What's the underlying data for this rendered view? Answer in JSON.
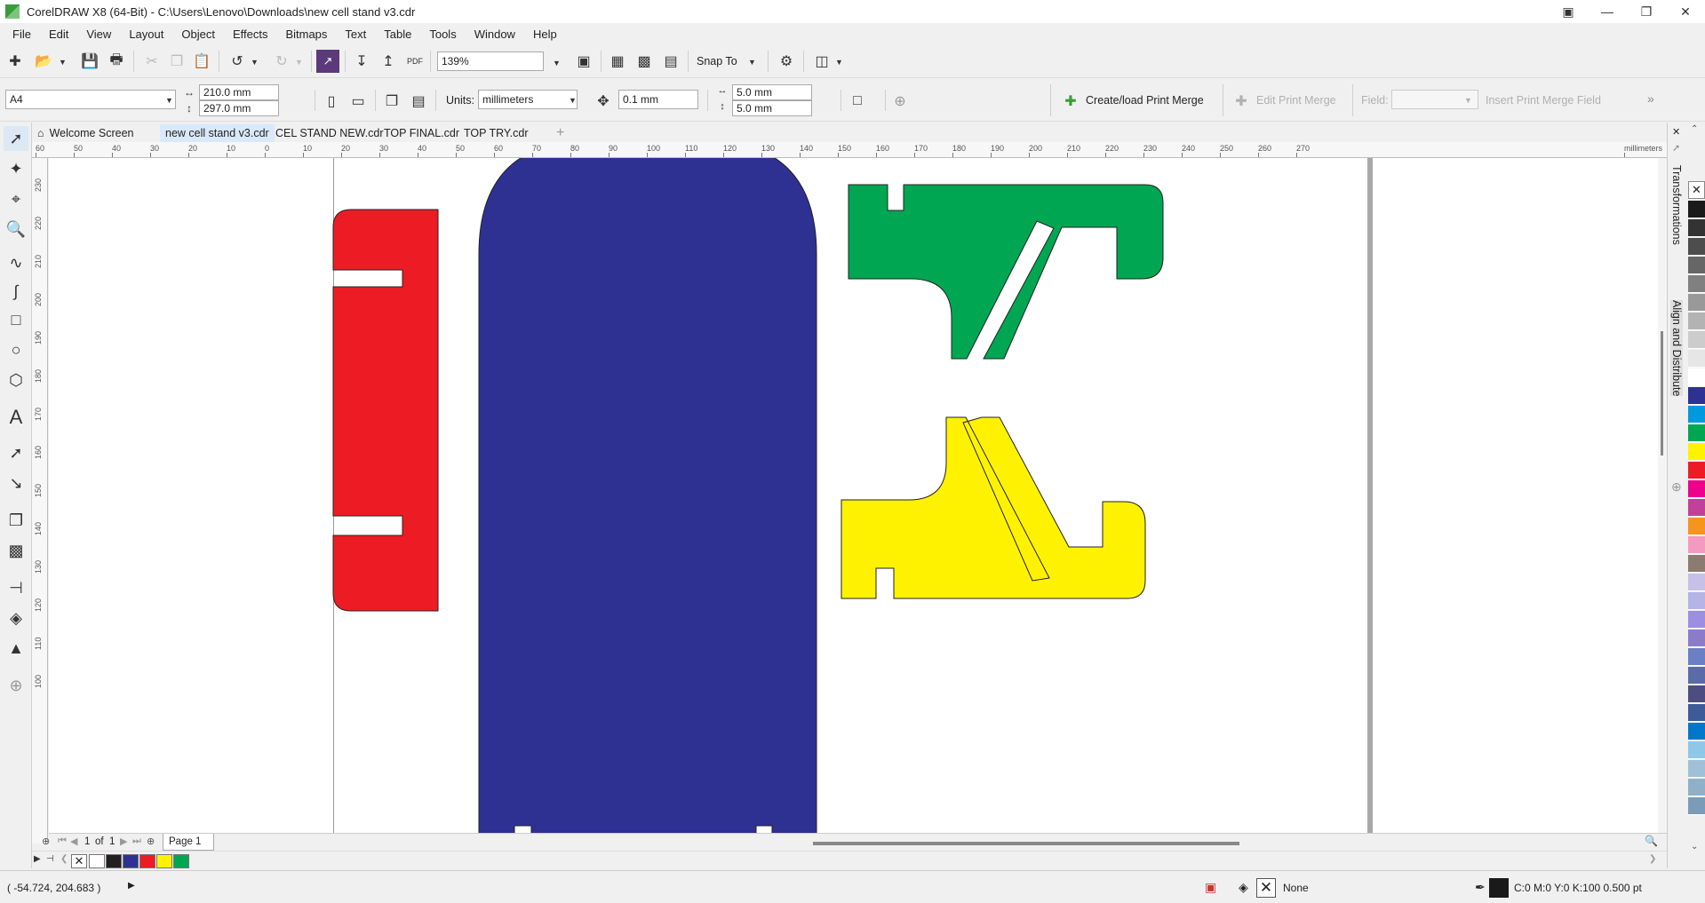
{
  "window": {
    "title": "CorelDRAW X8 (64-Bit) - C:\\Users\\Lenovo\\Downloads\\new cell stand v3.cdr"
  },
  "menu": [
    "File",
    "Edit",
    "View",
    "Layout",
    "Object",
    "Effects",
    "Bitmaps",
    "Text",
    "Table",
    "Tools",
    "Window",
    "Help"
  ],
  "stdbar": {
    "zoom": "139%",
    "snap_to": "Snap To"
  },
  "propbar": {
    "page_size": "A4",
    "width": "210.0 mm",
    "height": "297.0 mm",
    "units_label": "Units:",
    "units": "millimeters",
    "nudge": "0.1 mm",
    "dup_x": "5.0 mm",
    "dup_y": "5.0 mm",
    "print_merge": "Create/load Print Merge",
    "edit_merge": "Edit Print Merge",
    "field_label": "Field:",
    "insert_field": "Insert Print Merge Field"
  },
  "tabs": [
    {
      "label": "Welcome Screen"
    },
    {
      "label": "new cell stand v3.cdr"
    },
    {
      "label": "CEL STAND NEW.cdr"
    },
    {
      "label": "TOP FINAL.cdr"
    },
    {
      "label": "TOP TRY.cdr"
    }
  ],
  "ruler": {
    "units": "millimeters",
    "h_ticks": [
      "60",
      "50",
      "40",
      "30",
      "20",
      "10",
      "0",
      "10",
      "20",
      "30",
      "40",
      "50",
      "60",
      "70",
      "80",
      "90",
      "100",
      "110",
      "120",
      "130",
      "140",
      "150",
      "160",
      "170",
      "180",
      "190",
      "200",
      "210",
      "220",
      "230",
      "240",
      "250",
      "260",
      "270"
    ],
    "v_ticks": [
      "230",
      "220",
      "210",
      "200",
      "190",
      "180",
      "170",
      "160",
      "150",
      "140",
      "130",
      "120",
      "110",
      "100"
    ]
  },
  "shapes": {
    "colors": {
      "red": "#ed1c24",
      "blue": "#2e3192",
      "green": "#00a651",
      "yellow": "#fff200"
    }
  },
  "pagenav": {
    "current": "1",
    "of": "of",
    "total": "1",
    "page_tab": "Page 1"
  },
  "dockers": {
    "transformations": "Transformations",
    "align": "Align and Distribute"
  },
  "doc_palette": [
    "#ffffff",
    "#231f20",
    "#2e3192",
    "#ed1c24",
    "#fff200",
    "#00a651"
  ],
  "palette": [
    "#1a1a1a",
    "#333333",
    "#4d4d4d",
    "#666666",
    "#808080",
    "#999999",
    "#b3b3b3",
    "#cccccc",
    "#e6e6e6",
    "#ffffff",
    "#2e3192",
    "#0099dd",
    "#00a651",
    "#fff200",
    "#ed1c24",
    "#ec008c",
    "#c2409a",
    "#f7941d",
    "#f49ac1",
    "#8c7b70",
    "#c7c0e8",
    "#b4b4e6",
    "#9c8ee0",
    "#8a7cc9",
    "#6b7fc4",
    "#5a6ba8",
    "#4d4d80",
    "#3d5a99",
    "#0077c8",
    "#8ec7e8",
    "#a0c0d8",
    "#90b0c8",
    "#7a9cb8"
  ],
  "status": {
    "coords": "( -54.724, 204.683 )",
    "fill_none": "None",
    "outline": "C:0 M:0 Y:0 K:100  0.500 pt"
  }
}
